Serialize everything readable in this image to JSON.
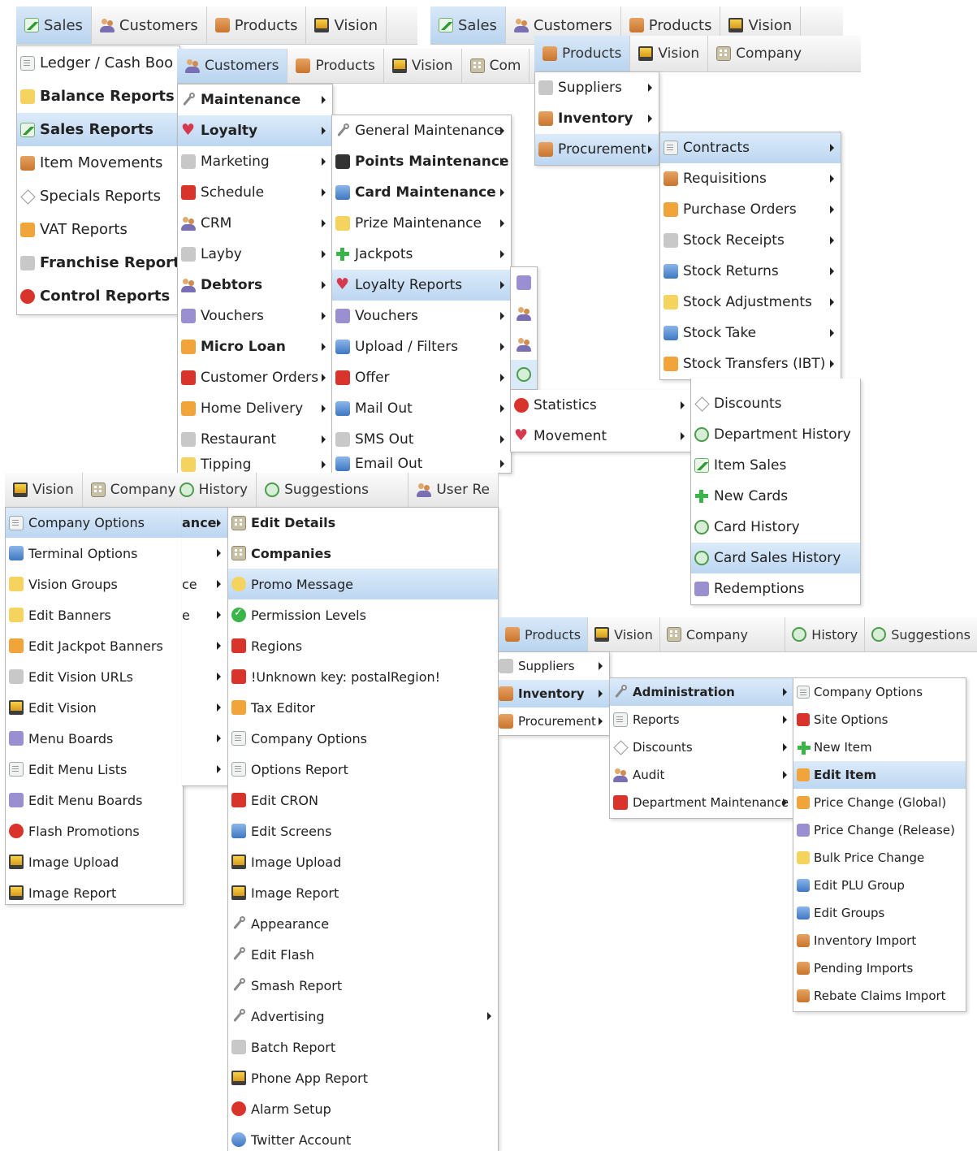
{
  "panel1": {
    "tabs": [
      "Sales",
      "Customers",
      "Products",
      "Vision"
    ],
    "menu": [
      {
        "label": "Ledger / Cash Boo",
        "icon": "ledger-icon",
        "bold": false
      },
      {
        "label": "Balance Reports",
        "icon": "scales-icon",
        "bold": true
      },
      {
        "label": "Sales Reports",
        "icon": "sales-chart-icon",
        "bold": true,
        "highlight": true
      },
      {
        "label": "Item Movements",
        "icon": "box-icon",
        "bold": false
      },
      {
        "label": "Specials Reports",
        "icon": "tag-icon",
        "bold": false
      },
      {
        "label": "VAT Reports",
        "icon": "vat-icon",
        "bold": false
      },
      {
        "label": "Franchise Report",
        "icon": "franchise-icon",
        "bold": true
      },
      {
        "label": "Control Reports",
        "icon": "traffic-light-icon",
        "bold": true
      }
    ]
  },
  "panel2": {
    "tabs": [
      "Customers",
      "Products",
      "Vision",
      "Com"
    ],
    "menu": [
      {
        "label": "Maintenance",
        "bold": true
      },
      {
        "label": "Loyalty",
        "bold": true,
        "highlight": true
      },
      {
        "label": "Marketing",
        "bold": false
      },
      {
        "label": "Schedule",
        "bold": false
      },
      {
        "label": "CRM",
        "bold": false
      },
      {
        "label": "Layby",
        "bold": false
      },
      {
        "label": "Debtors",
        "bold": true
      },
      {
        "label": "Vouchers",
        "bold": false
      },
      {
        "label": "Micro Loan",
        "bold": true
      },
      {
        "label": "Customer Orders",
        "bold": false
      },
      {
        "label": "Home Delivery",
        "bold": false
      },
      {
        "label": "Restaurant",
        "bold": false
      },
      {
        "label": "Tipping",
        "bold": false
      }
    ],
    "submenu": [
      {
        "label": "General Maintenance",
        "bold": false
      },
      {
        "label": "Points Maintenance",
        "bold": true
      },
      {
        "label": "Card Maintenance",
        "bold": true
      },
      {
        "label": "Prize Maintenance",
        "bold": false
      },
      {
        "label": "Jackpots",
        "bold": false
      },
      {
        "label": "Loyalty Reports",
        "bold": false,
        "highlight": true
      },
      {
        "label": "Vouchers",
        "bold": false
      },
      {
        "label": "Upload / Filters",
        "bold": false
      },
      {
        "label": "Offer",
        "bold": false
      },
      {
        "label": "Mail Out",
        "bold": false
      },
      {
        "label": "SMS Out",
        "bold": false
      },
      {
        "label": "Email Out",
        "bold": false
      }
    ]
  },
  "panel3": {
    "tabs": [
      "Sales",
      "Customers",
      "Products",
      "Vision"
    ],
    "bar2_tabs": [
      "Products",
      "Vision",
      "Company"
    ],
    "menu": [
      {
        "label": "Suppliers",
        "bold": false
      },
      {
        "label": "Inventory",
        "bold": true
      },
      {
        "label": "Procurement",
        "bold": false,
        "highlight": true
      }
    ],
    "submenu": [
      {
        "label": "Contracts",
        "highlight": true
      },
      {
        "label": "Requisitions"
      },
      {
        "label": "Purchase Orders"
      },
      {
        "label": "Stock Receipts"
      },
      {
        "label": "Stock Returns"
      },
      {
        "label": "Stock Adjustments"
      },
      {
        "label": "Stock Take"
      },
      {
        "label": "Stock Transfers (IBT)"
      }
    ]
  },
  "panel4": {
    "menu": [
      {
        "label": "Statistics"
      },
      {
        "label": "Movement"
      }
    ],
    "submenu": [
      {
        "label": "Discounts"
      },
      {
        "label": "Department History"
      },
      {
        "label": "Item Sales"
      },
      {
        "label": "New Cards"
      },
      {
        "label": "Card History"
      },
      {
        "label": "Card Sales History",
        "highlight": true
      },
      {
        "label": "Redemptions"
      }
    ]
  },
  "panel5": {
    "tabs": [
      "Vision",
      "Company",
      "History",
      "Suggestions",
      "User Re"
    ],
    "partial_label": "ance",
    "partial_items": [
      "ce",
      "e"
    ],
    "menu": [
      {
        "label": "Company Options",
        "highlight": true
      },
      {
        "label": "Terminal Options"
      },
      {
        "label": "Vision Groups"
      },
      {
        "label": "Edit Banners"
      },
      {
        "label": "Edit Jackpot Banners"
      },
      {
        "label": "Edit Vision URLs"
      },
      {
        "label": "Edit Vision"
      },
      {
        "label": "Menu Boards"
      },
      {
        "label": "Edit Menu Lists"
      },
      {
        "label": "Edit Menu Boards"
      },
      {
        "label": "Flash Promotions"
      },
      {
        "label": "Image Upload"
      },
      {
        "label": "Image Report"
      }
    ],
    "submenu": [
      {
        "label": "Edit Details",
        "bold": true
      },
      {
        "label": "Companies",
        "bold": true
      },
      {
        "label": "Promo Message",
        "highlight": true
      },
      {
        "label": "Permission Levels"
      },
      {
        "label": "Regions"
      },
      {
        "label": "!Unknown key: postalRegion!"
      },
      {
        "label": "Tax Editor"
      },
      {
        "label": "Company Options"
      },
      {
        "label": "Options Report"
      },
      {
        "label": "Edit CRON"
      },
      {
        "label": "Edit Screens"
      },
      {
        "label": "Image Upload"
      },
      {
        "label": "Image Report"
      },
      {
        "label": "Appearance"
      },
      {
        "label": "Edit Flash"
      },
      {
        "label": "Smash Report"
      },
      {
        "label": "Advertising",
        "arrow": true
      },
      {
        "label": "Batch Report"
      },
      {
        "label": "Phone App Report"
      },
      {
        "label": "Alarm Setup"
      },
      {
        "label": "Twitter Account"
      }
    ]
  },
  "panel6": {
    "tabs": [
      "Products",
      "Vision",
      "Company",
      "History",
      "Suggestions"
    ],
    "menu": [
      {
        "label": "Suppliers",
        "bold": false
      },
      {
        "label": "Inventory",
        "bold": true,
        "highlight": true
      },
      {
        "label": "Procurement",
        "bold": false
      }
    ],
    "submenu": [
      {
        "label": "Administration",
        "bold": true,
        "highlight": true
      },
      {
        "label": "Reports"
      },
      {
        "label": "Discounts"
      },
      {
        "label": "Audit"
      },
      {
        "label": "Department Maintenance"
      }
    ],
    "submenu2": [
      {
        "label": "Company Options"
      },
      {
        "label": "Site Options"
      },
      {
        "label": "New Item"
      },
      {
        "label": "Edit Item",
        "bold": true,
        "highlight": true
      },
      {
        "label": "Price Change (Global)"
      },
      {
        "label": "Price Change (Release)"
      },
      {
        "label": "Bulk Price Change"
      },
      {
        "label": "Edit PLU Group"
      },
      {
        "label": "Edit Groups"
      },
      {
        "label": "Inventory Import"
      },
      {
        "label": "Pending Imports"
      },
      {
        "label": "Rebate Claims Import"
      }
    ]
  },
  "colors": {
    "highlight": "#c6dcf3",
    "bar": "#eeeeee",
    "border": "#b9b9b9"
  }
}
